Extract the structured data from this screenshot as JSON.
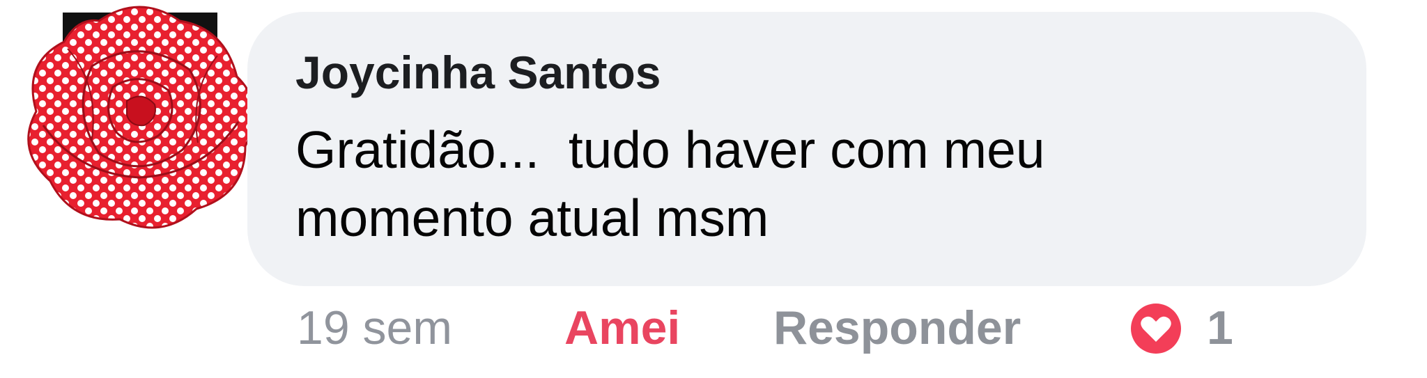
{
  "comment": {
    "author": "Joycinha Santos",
    "text": "Gratidão...  tudo haver com meu\nmomento atual msm",
    "avatar": "red-polka-dot-rose-avatar"
  },
  "actions": {
    "time": "19 sem",
    "like_label": "Amei",
    "reply_label": "Responder",
    "reaction_icon": "heart-icon",
    "reaction_count": "1"
  },
  "colors": {
    "bubble": "#f0f2f5",
    "like_active": "#e94560",
    "muted": "#8e9299",
    "heart": "#f33e58",
    "avatar_red": "#e8202f"
  }
}
